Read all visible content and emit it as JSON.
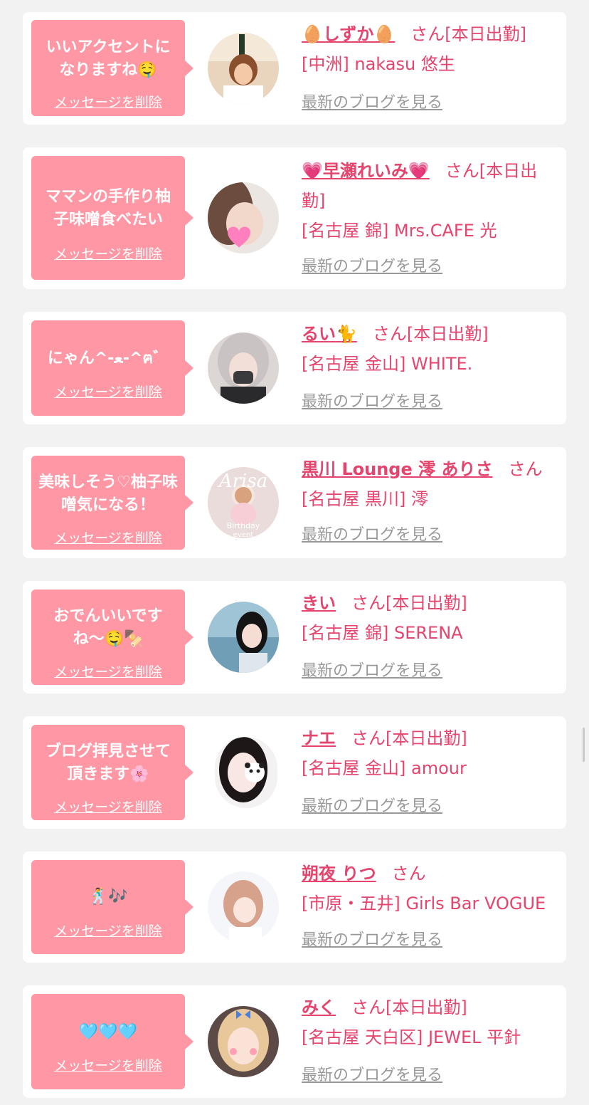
{
  "delete_label": "メッセージを削除",
  "blog_label": "最新のブログを見る",
  "san_suffix": "さん",
  "today_suffix": "[本日出勤]",
  "colors": {
    "background": "#f2f2f2",
    "card": "#ffffff",
    "bubble": "#ff97a5",
    "accent": "#e5446d",
    "blog_link": "#999999"
  },
  "items": [
    {
      "message": "いいアクセントになりますね🤤",
      "name": "🥚しずか🥚",
      "working_today": true,
      "shop": "[中洲] nakasu 悠生",
      "avatar": "avatar-photo"
    },
    {
      "message": "ママンの手作り柚子味噌食べたい",
      "name": "💗早瀬れいみ💗",
      "working_today": true,
      "shop": "[名古屋 錦] Mrs.CAFE 光",
      "avatar": "avatar-photo"
    },
    {
      "message": "にゃん^-ﻌ-^ฅ゛",
      "name": "るい🐈",
      "working_today": true,
      "shop": "[名古屋 金山] WHITE.",
      "avatar": "avatar-photo"
    },
    {
      "message": "美味しそう♡柚子味噌気になる！",
      "name": "黒川 Lounge 澪 ありさ",
      "working_today": false,
      "shop": "[名古屋 黒川] 澪",
      "avatar": "avatar-photo",
      "avatar_text": [
        "Arisa",
        "Birthday",
        "event"
      ]
    },
    {
      "message": "おでんいいですね〜🤤🍢",
      "name": "きい",
      "working_today": true,
      "shop": "[名古屋 錦] SERENA",
      "avatar": "avatar-photo"
    },
    {
      "message": "ブログ拝見させて頂きます🌸",
      "name": "ナエ",
      "working_today": true,
      "shop": "[名古屋 金山] amour",
      "avatar": "avatar-photo"
    },
    {
      "message": "🕺🎶",
      "name": "朔夜 りつ",
      "working_today": false,
      "shop": "[市原・五井] Girls Bar VOGUE",
      "avatar": "avatar-photo"
    },
    {
      "message": "🩵🩵🩵",
      "name": "みく",
      "working_today": true,
      "shop": "[名古屋 天白区] JEWEL 平針",
      "avatar": "avatar-photo"
    }
  ]
}
